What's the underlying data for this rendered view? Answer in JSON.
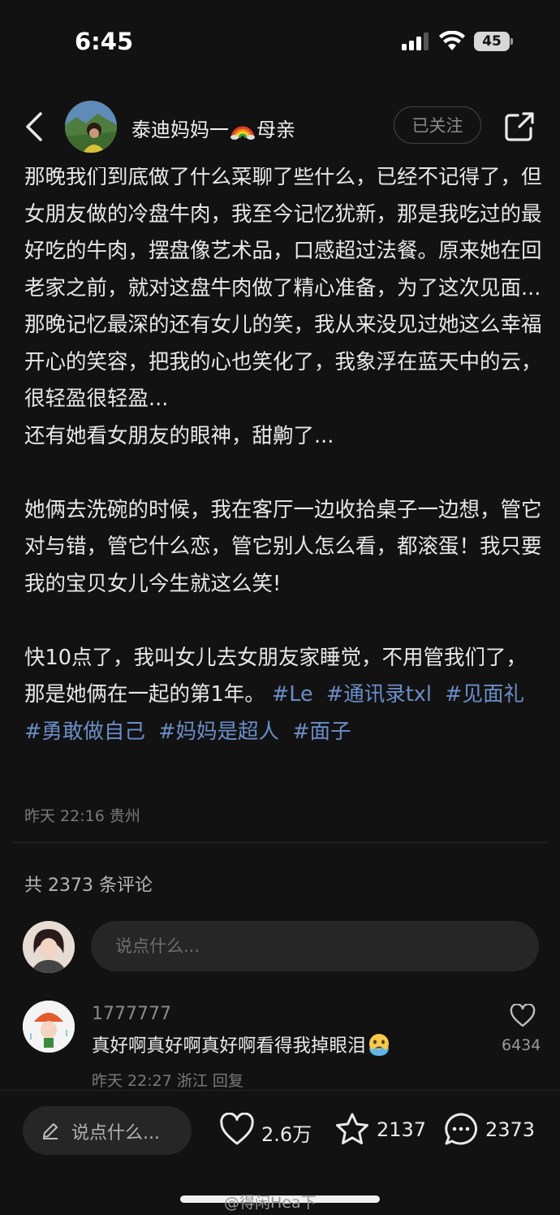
{
  "status_bar": {
    "time": "6:45",
    "battery": "45"
  },
  "header": {
    "author": "泰迪妈妈一",
    "author_suffix": "母亲",
    "author_emoji": "rainbow-emoji",
    "follow_label": "已关注"
  },
  "post": {
    "paragraphs": [
      "那晚我们到底做了什么菜聊了些什么，已经不记得了，但女朋友做的冷盘牛肉，我至今记忆犹新，那是我吃过的最好吃的牛肉，摆盘像艺术品，口感超过法餐。原来她在回老家之前，就对这盘牛肉做了精心准备，为了这次见面...",
      "那晚记忆最深的还有女儿的笑，我从来没见过她这么幸福开心的笑容，把我的心也笑化了，我象浮在蓝天中的云，很轻盈很轻盈...",
      "还有她看女朋友的眼神，甜齁了...",
      "",
      "她俩去洗碗的时候，我在客厅一边收拾桌子一边想，管它对与错，管它什么恋，管它别人怎么看，都滚蛋！我只要我的宝贝女儿今生就这么笑!",
      "",
      "快10点了，我叫女儿去女朋友家睡觉，不用管我们了，那是她俩在一起的第1年。"
    ],
    "tags": [
      "#Le",
      "#通讯录txl",
      "#见面礼",
      "#勇敢做自己",
      "#妈妈是超人",
      "#面子"
    ],
    "meta": "昨天 22:16 贵州"
  },
  "comments": {
    "count_label": "共 2373 条评论",
    "input_placeholder": "说点什么...",
    "items": [
      {
        "user": "1777777",
        "text": "真好啊真好啊真好啊看得我掉眼泪",
        "emoji": "crying-face-emoji",
        "time": "昨天 22:27",
        "location": "浙江",
        "reply_label": "回复",
        "likes": "6434"
      }
    ]
  },
  "bottom_bar": {
    "input_label": "说点什么...",
    "likes": "2.6万",
    "favorites": "2137",
    "comments": "2373"
  },
  "watermark": "@得闲Hea下",
  "colors": {
    "background": "#121212",
    "tag": "#6b8ec9",
    "muted": "#7a7a7a"
  }
}
